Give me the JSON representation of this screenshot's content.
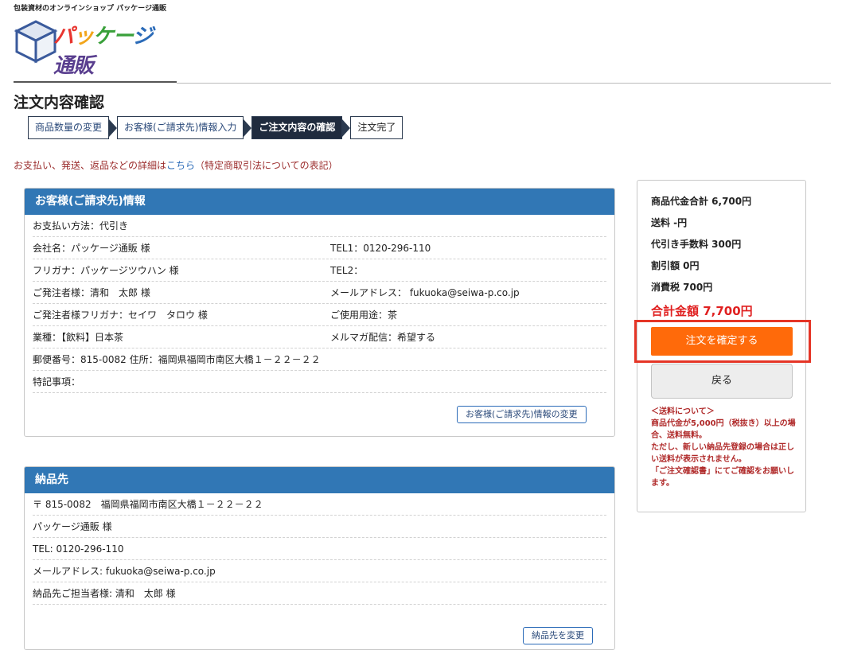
{
  "header": {
    "tagline": "包装資材のオンラインショップ パッケージ通販",
    "logo_text": [
      "パ",
      "ッ",
      "ケー",
      "ジ",
      "通販"
    ]
  },
  "page_title": "注文内容確認",
  "steps": [
    {
      "label": "商品数量の変更"
    },
    {
      "label": "お客様(ご請求先)情報入力"
    },
    {
      "label": "ご注文内容の確認"
    },
    {
      "label": "注文完了"
    }
  ],
  "notice": {
    "before": "お支払い、発送、返品などの詳細は",
    "link": "こちら",
    "after": "（特定商取引法についての表記）"
  },
  "customer": {
    "title": "お客様(ご請求先)情報",
    "payment": "お支払い方法：代引き",
    "company": "会社名：パッケージ通販 様",
    "tel1": "TEL1：0120-296-110",
    "furigana": "フリガナ：パッケージツウハン 様",
    "tel2": "TEL2：",
    "orderer": "ご発注者様：清和　太郎 様",
    "email": "メールアドレス： fukuoka@seiwa-p.co.jp",
    "orderer_furigana": "ご発注者様フリガナ：セイワ　タロウ 様",
    "usage": "ご使用用途：茶",
    "industry": "業種：【飲料】日本茶",
    "newsletter": "メルマガ配信：希望する",
    "address": "郵便番号：815-0082 住所：福岡県福岡市南区大橋１－２２－２２",
    "remarks": "特記事項：",
    "change_button": "お客様(ご請求先)情報の変更"
  },
  "delivery": {
    "title": "納品先",
    "address": "〒 815-0082　福岡県福岡市南区大橋１－２２－２２",
    "name": "パッケージ通販 様",
    "tel": "TEL: 0120-296-110",
    "email": "メールアドレス: fukuoka@seiwa-p.co.jp",
    "contact": "納品先ご担当者様: 清和　太郎 様",
    "change_button": "納品先を変更"
  },
  "summary": {
    "subtotal": "商品代金合計 6,700円",
    "shipping": "送料 -円",
    "cod_fee": "代引き手数料 300円",
    "discount": "割引額 0円",
    "tax": "消費税 700円",
    "total": "合計金額 7,700円",
    "confirm_button": "注文を確定する",
    "back_button": "戻る",
    "shipping_note": "＜送料について＞\n商品代金が5,000円（税抜き）以上の場合、送料無料。\nただし、新しい納品先登録の場合は正しい送料が表示されません。\n「ご注文確認書」にてご確認をお願いします。"
  }
}
